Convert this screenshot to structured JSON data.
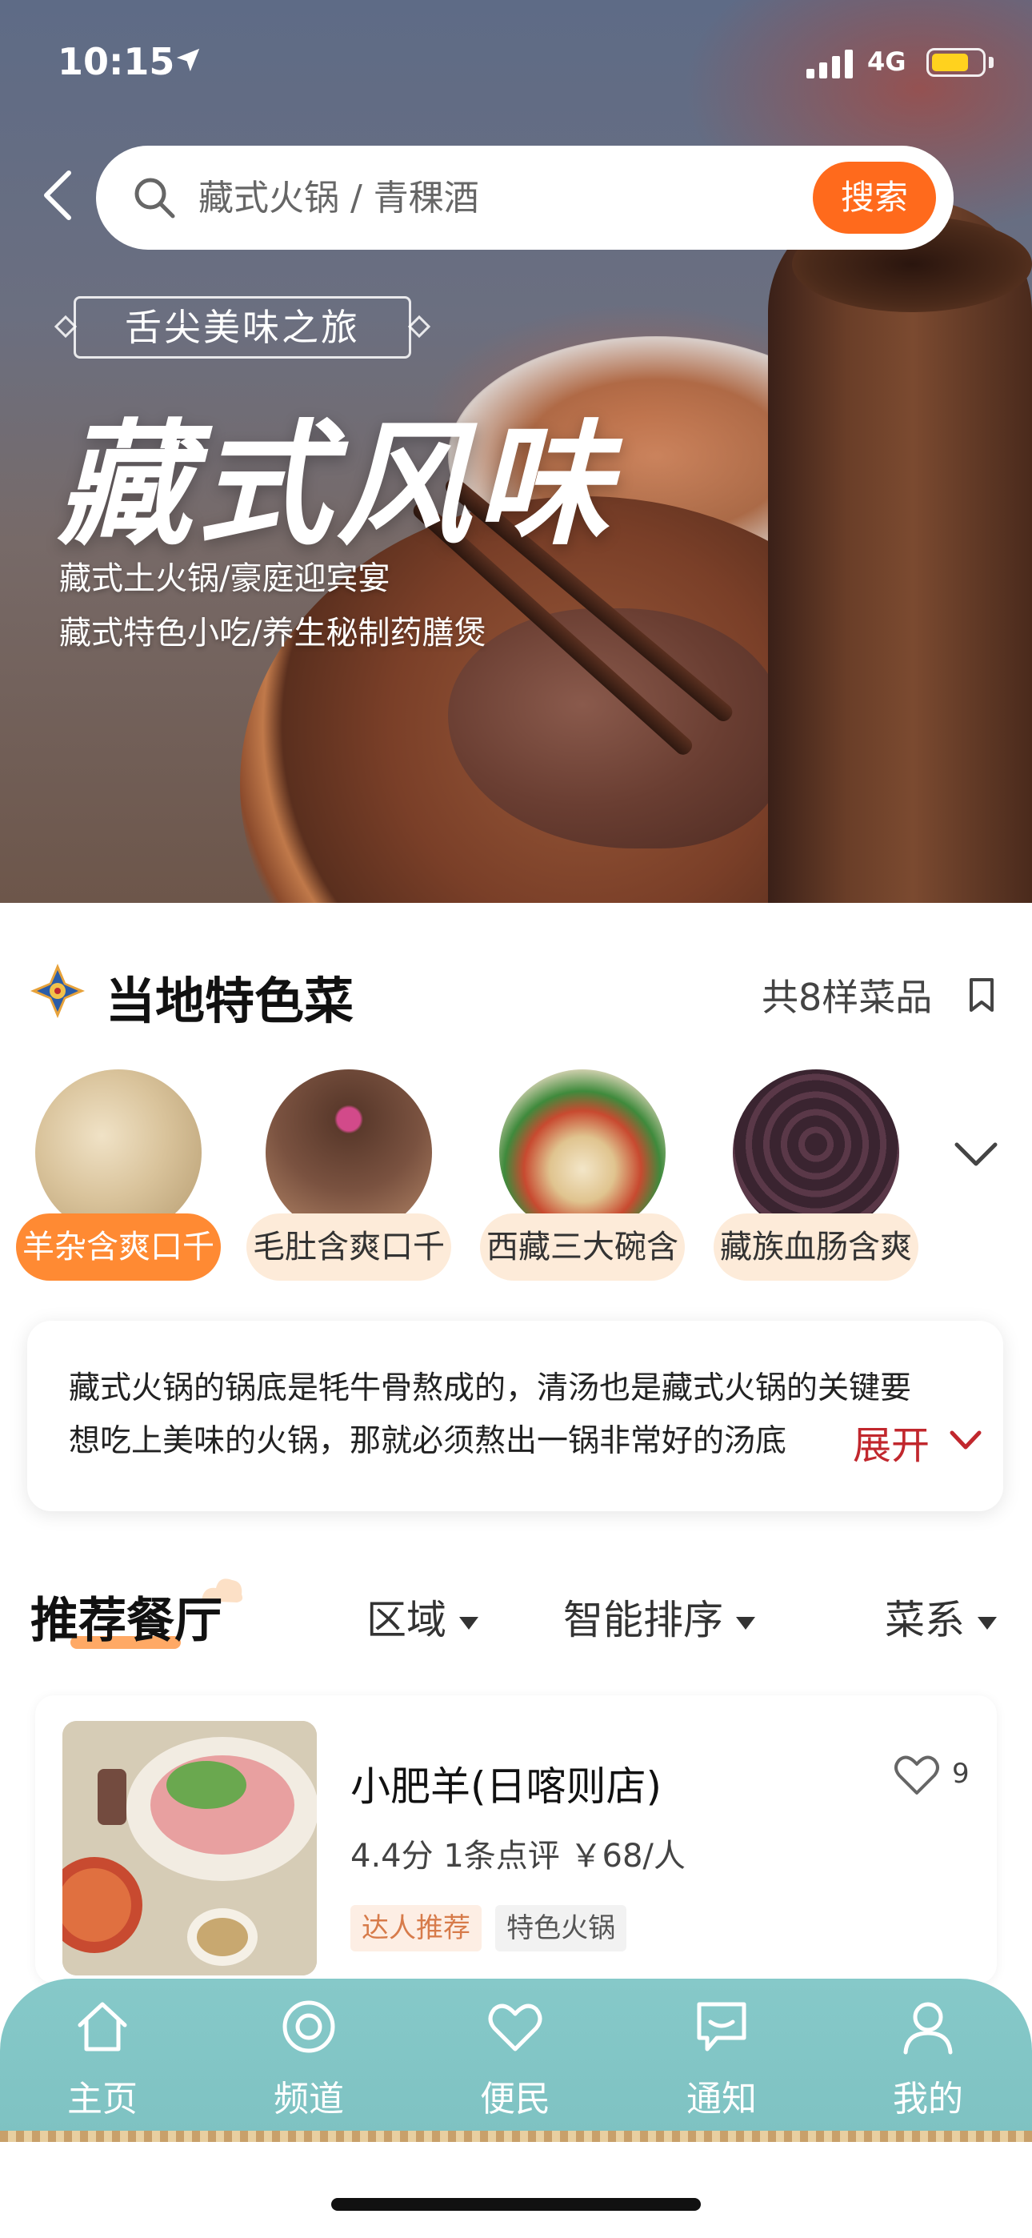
{
  "status_bar": {
    "time": "10:15",
    "network": "4G",
    "battery_level": 0.75
  },
  "search": {
    "placeholder": "藏式火锅 / 青稞酒",
    "button_label": "搜索"
  },
  "hero": {
    "tagline": "舌尖美味之旅",
    "title": "藏式风味",
    "subtitle_line1": "藏式土火锅/豪庭迎宾宴",
    "subtitle_line2": "藏式特色小吃/养生秘制药膳煲"
  },
  "specialty": {
    "title": "当地特色菜",
    "count": "共8样菜品",
    "dishes": [
      {
        "label": "羊杂含爽口千",
        "active": true
      },
      {
        "label": "毛肚含爽口千",
        "active": false
      },
      {
        "label": "西藏三大碗含",
        "active": false
      },
      {
        "label": "藏族血肠含爽",
        "active": false
      }
    ]
  },
  "description": {
    "line1": "藏式火锅的锅底是牦牛骨熬成的，清汤也是藏式火锅的关键要",
    "line2": "想吃上美味的火锅，那就必须熬出一锅非常好的汤底",
    "expand_label": "展开"
  },
  "recommend": {
    "title": "推荐餐厅",
    "filters": [
      "区域",
      "智能排序",
      "菜系"
    ],
    "restaurants": [
      {
        "name": "小肥羊(日喀则店)",
        "meta": "4.4分 1条点评 ￥68/人",
        "tags": [
          "达人推荐",
          "特色火锅"
        ],
        "favorites": "9"
      }
    ]
  },
  "tabbar": {
    "items": [
      "主页",
      "频道",
      "便民",
      "通知",
      "我的"
    ]
  },
  "colors": {
    "accent": "#ff6a1c",
    "tab_bg": "#7ec2c2",
    "expand": "#c1272d",
    "chip": "#fdebd9"
  }
}
